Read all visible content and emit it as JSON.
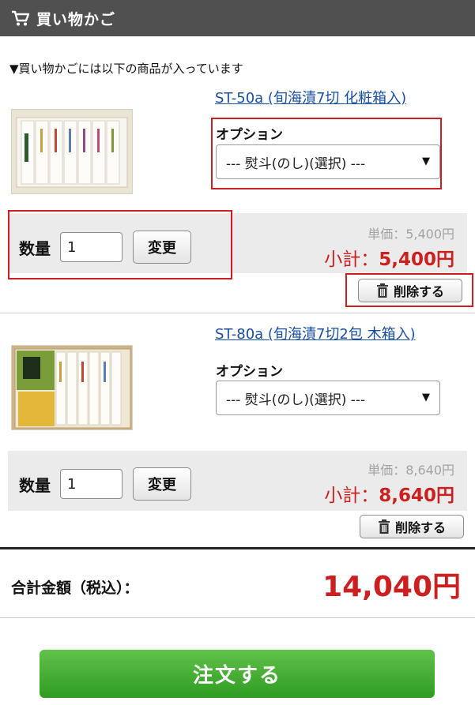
{
  "header": {
    "title": "買い物かご",
    "icon": "cart-icon"
  },
  "intro": "▼買い物かごには以下の商品が入っています",
  "items": [
    {
      "name": "ST-50a (旬海漬7切 化粧箱入)",
      "option_label": "オプション",
      "option_value": "--- 熨斗(のし)(選択) ---",
      "quantity_label": "数量",
      "quantity_value": "1",
      "change_label": "変更",
      "unit_price": "単価：5,400円",
      "subtotal_label": "小計：",
      "subtotal_value": "5,400円",
      "delete_label": "削除する"
    },
    {
      "name": "ST-80a (旬海漬7切2包 木箱入)",
      "option_label": "オプション",
      "option_value": "--- 熨斗(のし)(選択) ---",
      "quantity_label": "数量",
      "quantity_value": "1",
      "change_label": "変更",
      "unit_price": "単価：8,640円",
      "subtotal_label": "小計：",
      "subtotal_value": "8,640円",
      "delete_label": "削除する"
    }
  ],
  "total": {
    "label": "合計金額（税込）：",
    "value": "14,040円"
  },
  "order_button": "注文する",
  "colors": {
    "header_bg": "#505050",
    "accent_red": "#cc1f1f",
    "link": "#1a4fa0",
    "order_green": "#3aa52c"
  }
}
